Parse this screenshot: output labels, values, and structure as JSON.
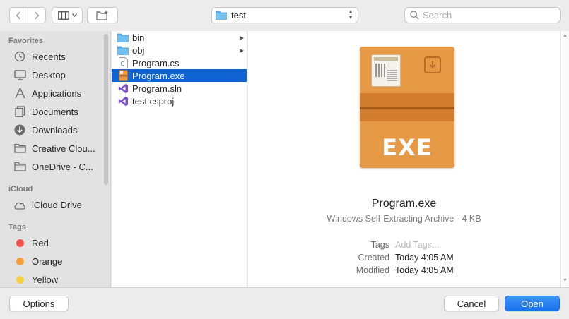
{
  "toolbar": {
    "back_icon": "chevron-left-icon",
    "forward_icon": "chevron-right-icon",
    "view_icon": "column-view-icon",
    "new_folder_icon": "new-folder-icon",
    "location": "test",
    "search_placeholder": "Search"
  },
  "sidebar": {
    "favorites_title": "Favorites",
    "favorites": [
      {
        "label": "Recents",
        "icon": "clock-icon"
      },
      {
        "label": "Desktop",
        "icon": "desktop-icon"
      },
      {
        "label": "Applications",
        "icon": "applications-icon"
      },
      {
        "label": "Documents",
        "icon": "documents-icon"
      },
      {
        "label": "Downloads",
        "icon": "downloads-icon"
      },
      {
        "label": "Creative Clou...",
        "icon": "folder-icon"
      },
      {
        "label": "OneDrive - C...",
        "icon": "folder-icon"
      }
    ],
    "icloud_title": "iCloud",
    "icloud": [
      {
        "label": "iCloud Drive",
        "icon": "cloud-icon"
      }
    ],
    "tags_title": "Tags",
    "tags": [
      {
        "label": "Red",
        "color": "#f2504c"
      },
      {
        "label": "Orange",
        "color": "#f5a13b"
      },
      {
        "label": "Yellow",
        "color": "#f6cf3e"
      }
    ]
  },
  "files": [
    {
      "name": "bin",
      "type": "folder",
      "has_children": true
    },
    {
      "name": "obj",
      "type": "folder",
      "has_children": true
    },
    {
      "name": "Program.cs",
      "type": "csharp",
      "has_children": false
    },
    {
      "name": "Program.exe",
      "type": "exe",
      "has_children": false,
      "selected": true
    },
    {
      "name": "Program.sln",
      "type": "visualstudio",
      "has_children": false
    },
    {
      "name": "test.csproj",
      "type": "visualstudio",
      "has_children": false
    }
  ],
  "preview": {
    "icon_label": "EXE",
    "name": "Program.exe",
    "kind": "Windows Self-Extracting Archive - 4 KB",
    "tags_label": "Tags",
    "tags_placeholder": "Add Tags...",
    "created_label": "Created",
    "created_value": "Today 4:05 AM",
    "modified_label": "Modified",
    "modified_value": "Today 4:05 AM"
  },
  "buttons": {
    "options": "Options",
    "cancel": "Cancel",
    "open": "Open"
  },
  "colors": {
    "selection": "#0f63d3",
    "accent": "#1671ee",
    "exe_orange": "#e79a45"
  }
}
